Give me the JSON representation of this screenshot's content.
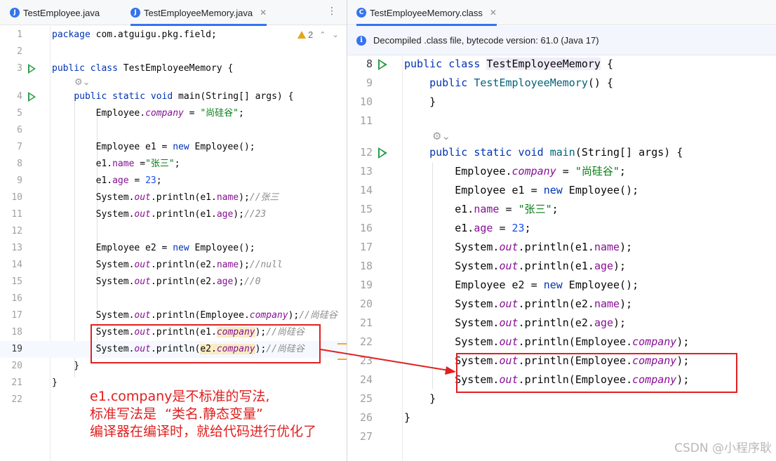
{
  "left_tabs": [
    {
      "label": "TestEmployee.java",
      "active": false
    },
    {
      "label": "TestEmployeeMemory.java",
      "active": true
    }
  ],
  "right_tabs": [
    {
      "label": "TestEmployeeMemory.class",
      "active": true
    }
  ],
  "warnings": {
    "count": "2"
  },
  "decompiled_banner": "Decompiled .class file, bytecode version: 61.0 (Java 17)",
  "left_code": {
    "lines": [
      "1",
      "2",
      "3",
      "4",
      "5",
      "6",
      "7",
      "8",
      "9",
      "10",
      "11",
      "12",
      "13",
      "14",
      "15",
      "16",
      "17",
      "18",
      "19",
      "20",
      "21",
      "22"
    ],
    "package": "package com.atguigu.pkg.field;",
    "class_name": "TestEmployeeMemory",
    "company_value": "\"尚硅谷\"",
    "name_value": "\"张三\"",
    "age_value": "23",
    "comments": {
      "c10": "//张三",
      "c11": "//23",
      "c14": "//null",
      "c15": "//0",
      "c17": "//尚硅谷",
      "c18": "//尚硅谷",
      "c19": "//尚硅谷"
    }
  },
  "right_code": {
    "lines": [
      "8",
      "9",
      "10",
      "11",
      "12",
      "13",
      "14",
      "15",
      "16",
      "17",
      "18",
      "19",
      "20",
      "21",
      "22",
      "23",
      "24",
      "25",
      "26",
      "27"
    ],
    "class_name": "TestEmployeeMemory"
  },
  "annotation": {
    "line1": "e1.company是不标准的写法,",
    "line2": "标准写法是  “类名.静态变量”",
    "line3": "编译器在编译时，就给代码进行优化了"
  },
  "watermark": "CSDN @小程序耿",
  "colors": {
    "accent": "#3574f0",
    "annotation": "#e02020",
    "run": "#2e9d4b",
    "keyword": "#0033b3",
    "field": "#871094",
    "string": "#067d17"
  }
}
